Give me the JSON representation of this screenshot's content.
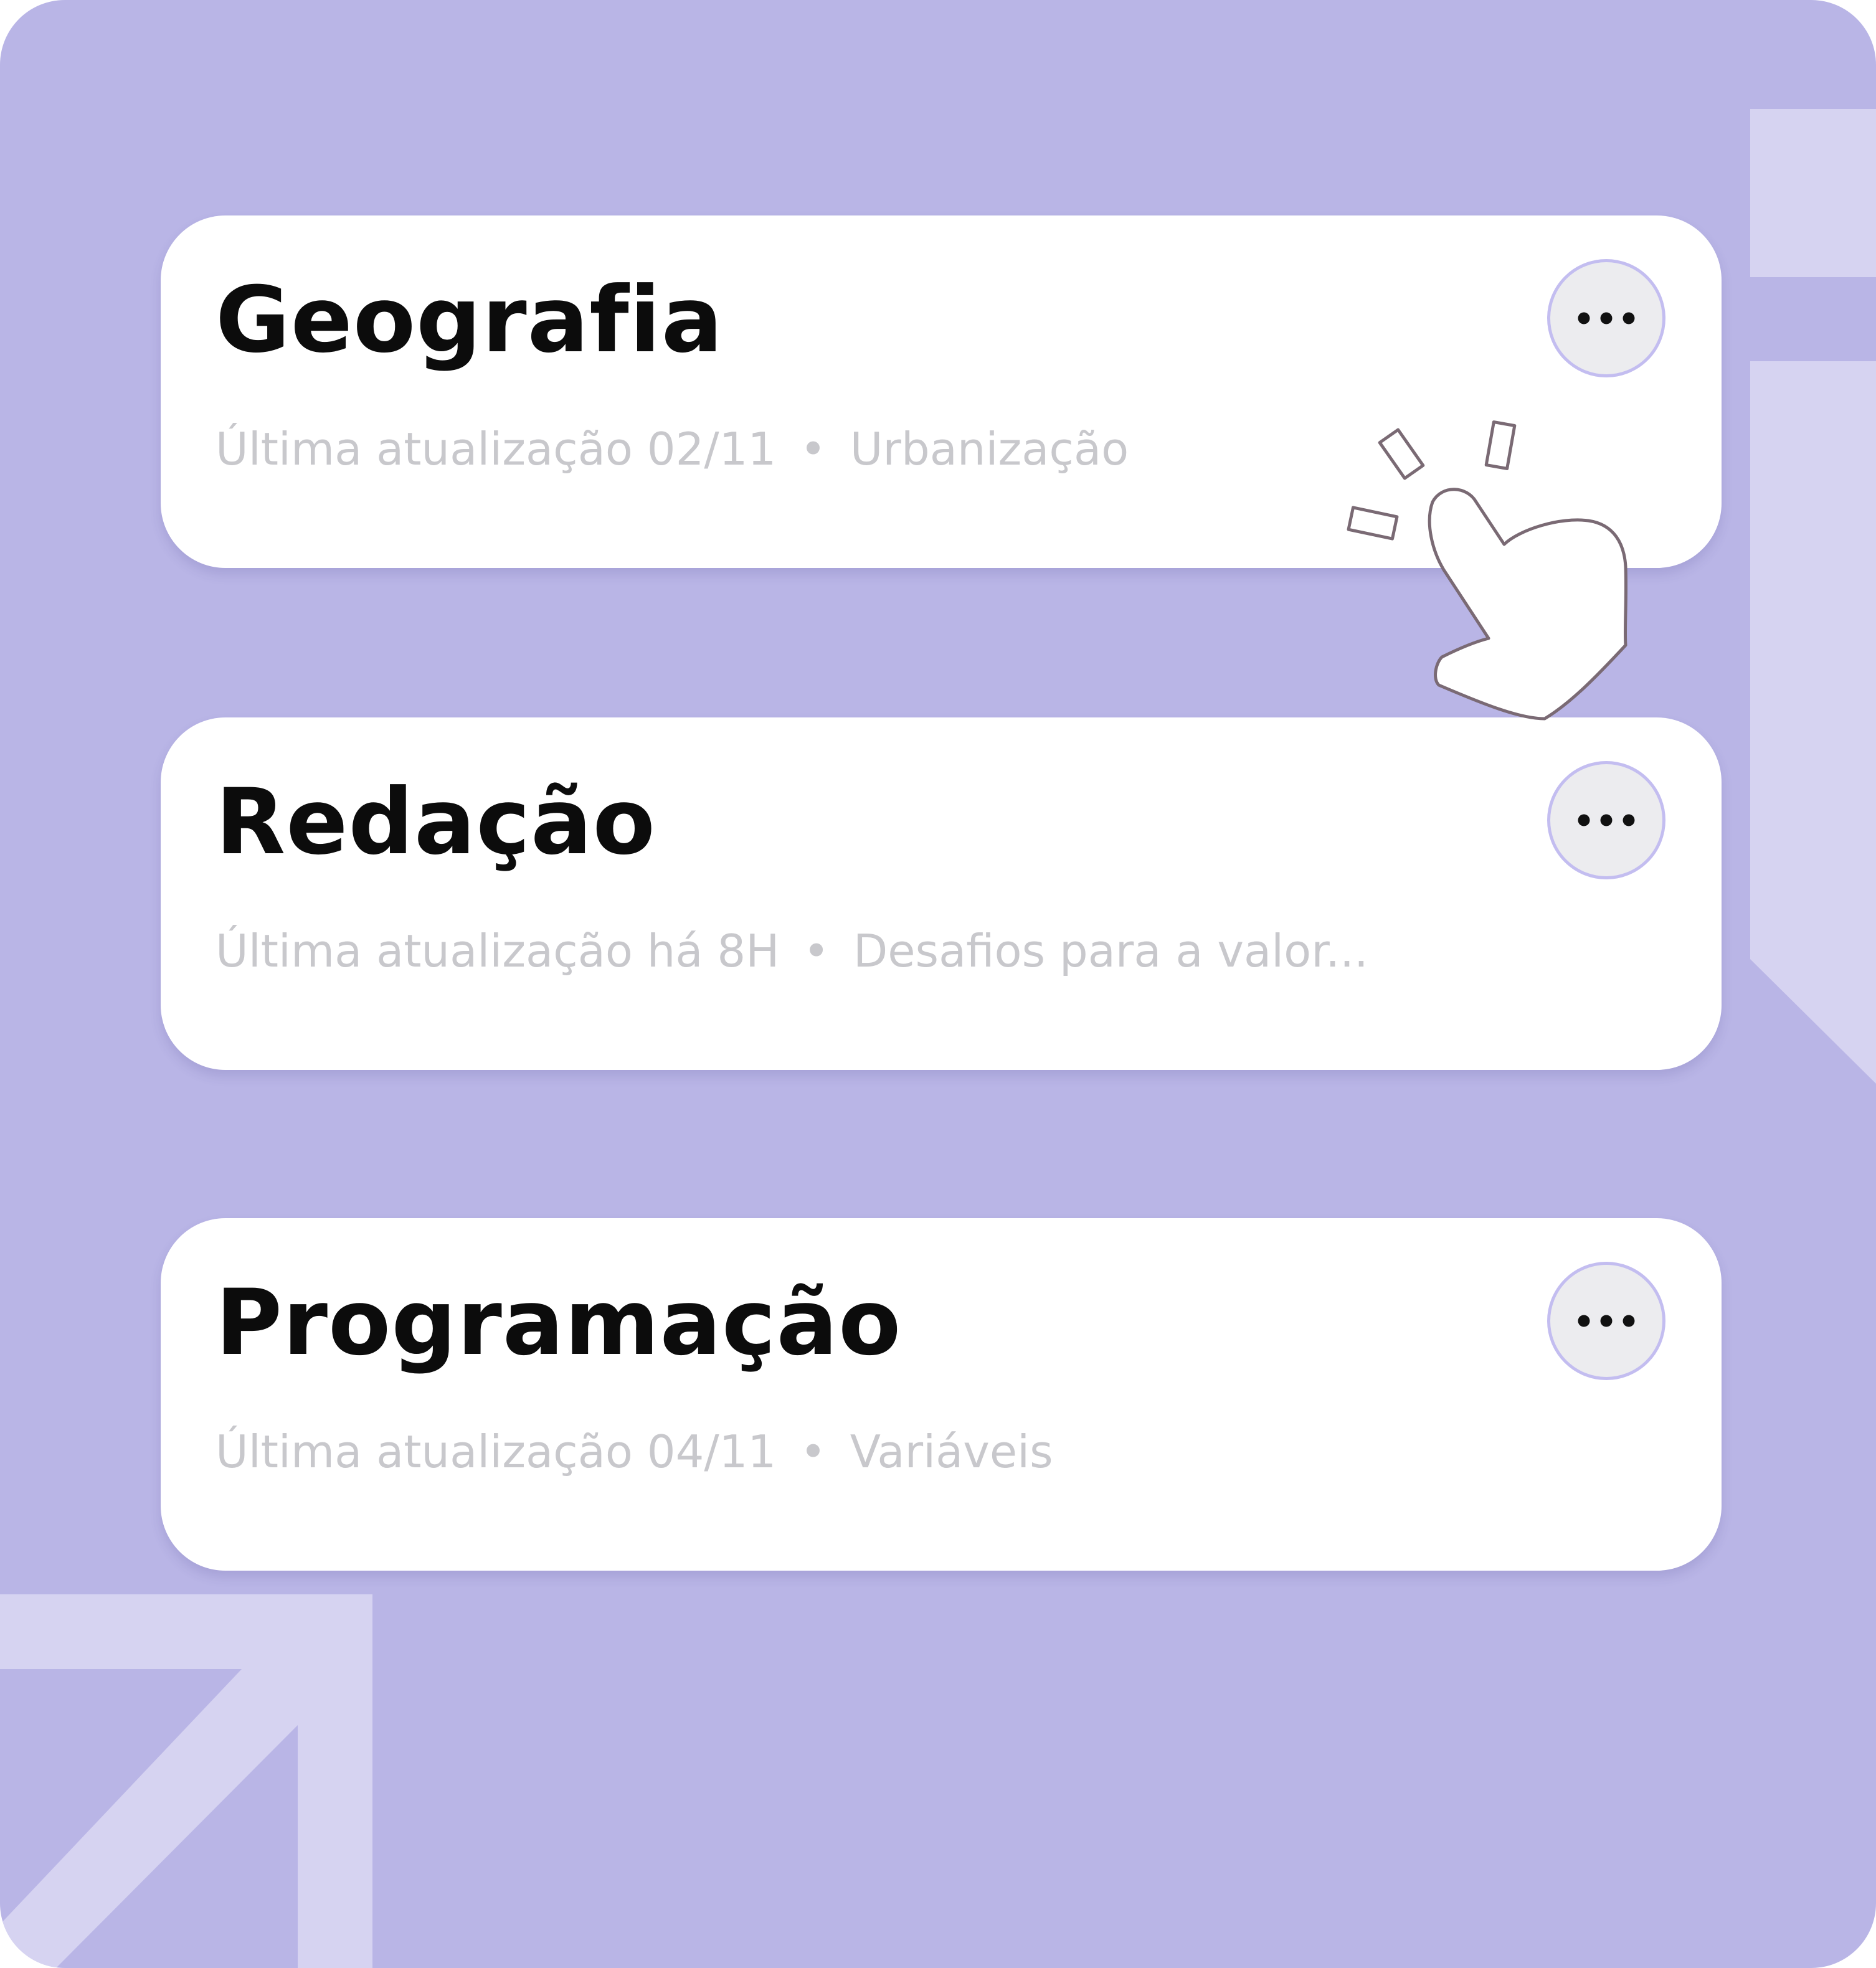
{
  "cards": [
    {
      "title": "Geografia",
      "updated": "Última atualização 02/11",
      "separator": "•",
      "topic": "Urbanização",
      "menu_icon": "more-horizontal-icon"
    },
    {
      "title": "Redação",
      "updated": "Última atualização há 8H",
      "separator": "•",
      "topic": "Desafios para a valor...",
      "menu_icon": "more-horizontal-icon"
    },
    {
      "title": "Programação",
      "updated": "Última atualização 04/11",
      "separator": "•",
      "topic": "Variáveis",
      "menu_icon": "more-horizontal-icon"
    }
  ],
  "colors": {
    "background": "#b9b5e6",
    "decoration": "#d6d3f1",
    "card": "#ffffff",
    "title_text": "#0c0c0c",
    "meta_text": "#c8c8cc",
    "menu_button": "#ececef",
    "menu_button_border": "#c3bdf0"
  },
  "pointer_icon": "tap-hand-icon"
}
